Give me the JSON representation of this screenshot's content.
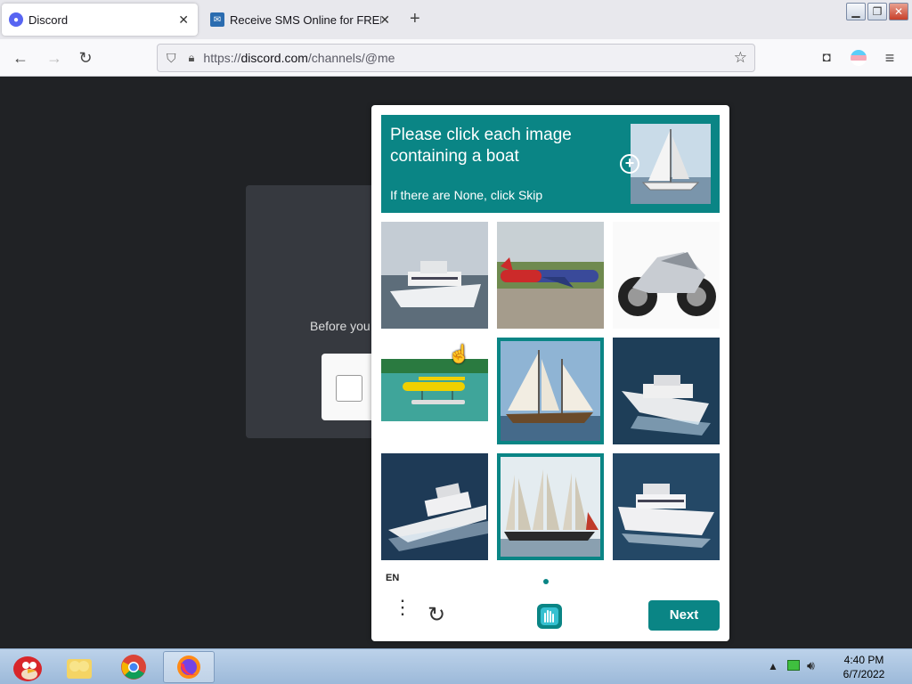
{
  "tabs": [
    {
      "title": "Discord",
      "icon": "discord-icon",
      "active": true
    },
    {
      "title": "Receive SMS Online for FREE",
      "icon": "sms-site-icon",
      "active": false
    }
  ],
  "new_tab_label": "+",
  "url": {
    "scheme": "https://",
    "host": "discord.com",
    "path": "/channels/@me"
  },
  "page": {
    "auth_text": "Before you"
  },
  "captcha": {
    "title": "Please click each image containing a boat",
    "subtitle": "If there are None, click Skip",
    "grid": [
      {
        "subject": "motor yacht",
        "selected": false
      },
      {
        "subject": "airplane",
        "selected": false
      },
      {
        "subject": "motorcycle",
        "selected": false
      },
      {
        "subject": "seaplane",
        "selected": false
      },
      {
        "subject": "sailing ship",
        "selected": true
      },
      {
        "subject": "motor yacht",
        "selected": false
      },
      {
        "subject": "motor yacht",
        "selected": false
      },
      {
        "subject": "tall ship",
        "selected": true
      },
      {
        "subject": "motor yacht",
        "selected": false
      }
    ],
    "language": "EN",
    "next_label": "Next",
    "accent_color": "#0a8585"
  },
  "taskbar": {
    "apps": [
      "angry-birds-icon",
      "folder-icon",
      "chrome-icon",
      "firefox-icon"
    ],
    "time": "4:40 PM",
    "date": "6/7/2022"
  }
}
